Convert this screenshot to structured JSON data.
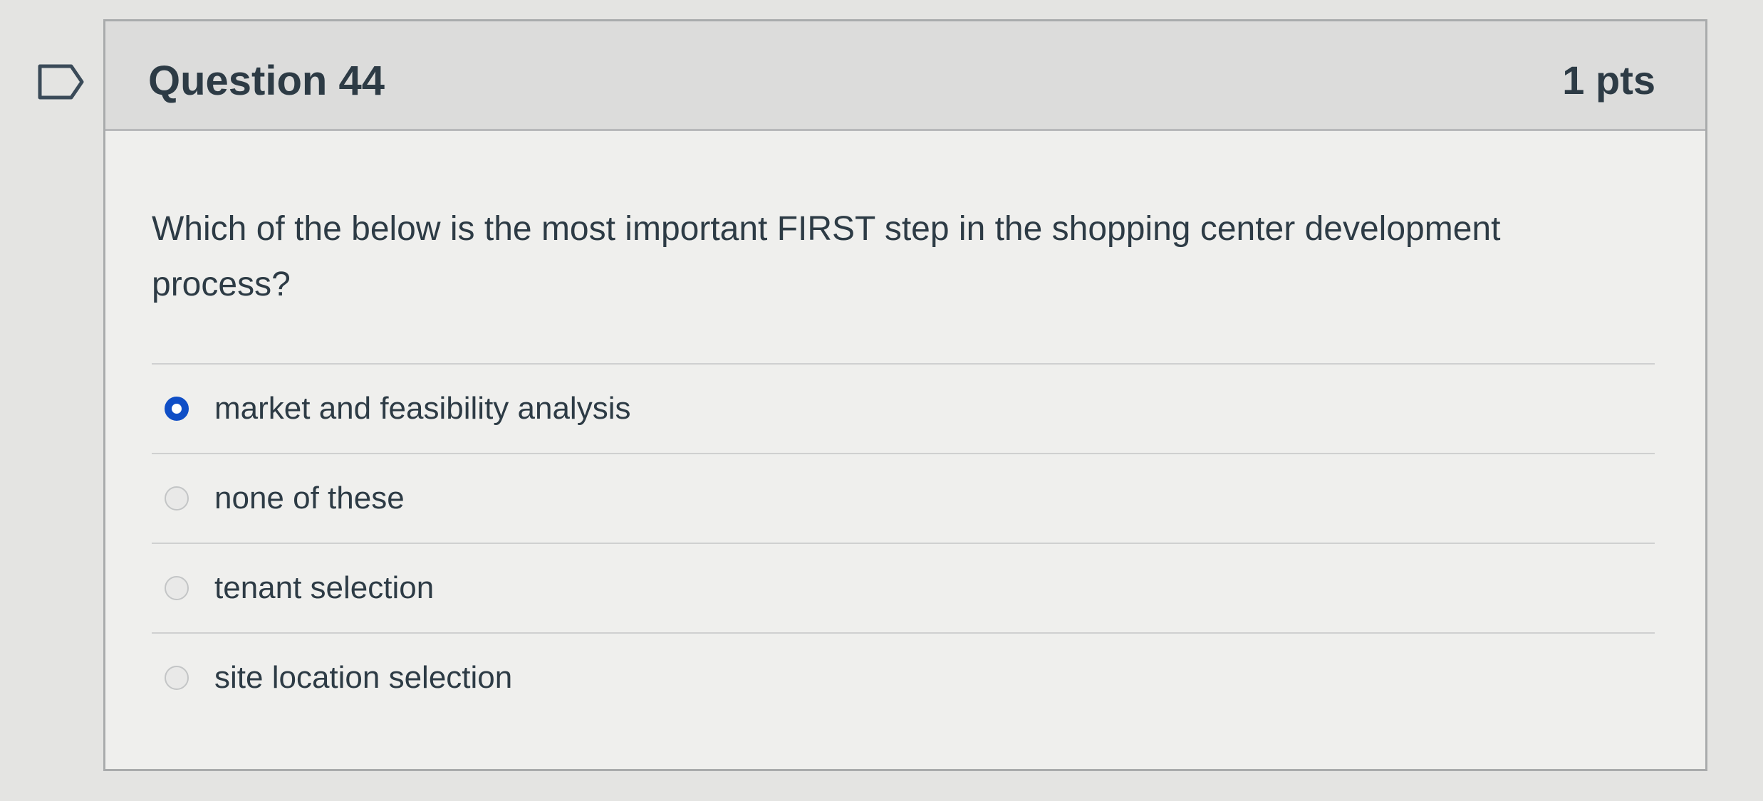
{
  "question": {
    "title": "Question 44",
    "points": "1 pts",
    "text": "Which of the below is the most important FIRST step in the shopping center development process?",
    "flag_icon": "flag-icon",
    "answers": [
      {
        "label": "market and feasibility analysis",
        "selected": true
      },
      {
        "label": "none of these",
        "selected": false
      },
      {
        "label": "tenant selection",
        "selected": false
      },
      {
        "label": "site location selection",
        "selected": false
      }
    ]
  },
  "colors": {
    "selected_radio": "#0f4ec6",
    "header_bg": "#dcdcdb",
    "text": "#2d3b45"
  }
}
